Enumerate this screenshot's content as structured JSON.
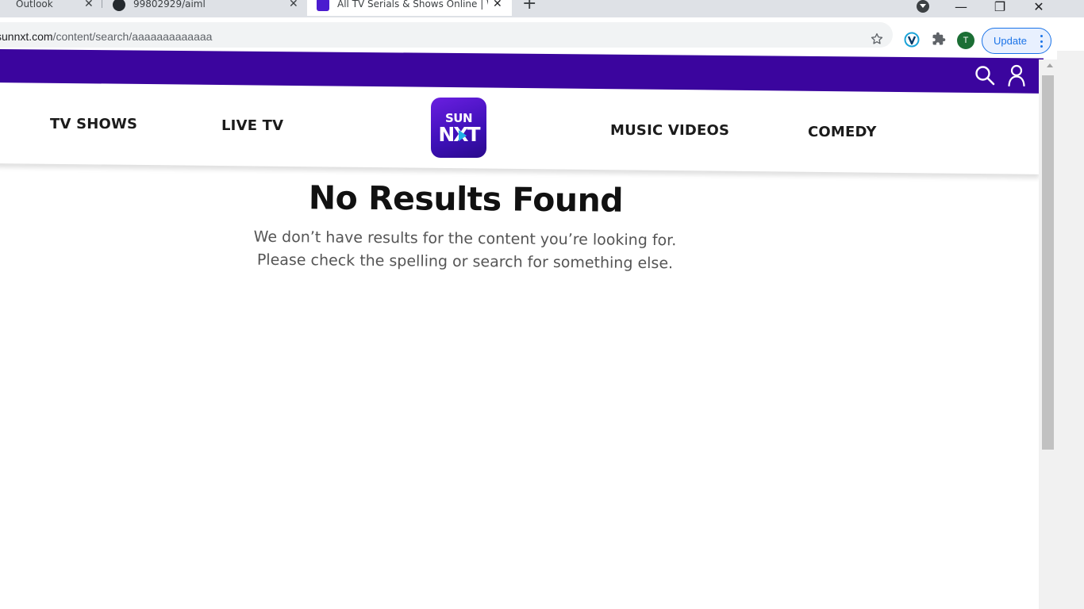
{
  "browser": {
    "tabs": [
      {
        "title": "Outlook",
        "active": false
      },
      {
        "title": "99802929/aiml",
        "active": false
      },
      {
        "title": "All TV Serials & Shows Online | W",
        "active": true
      }
    ],
    "new_tab_symbol": "+",
    "close_symbol": "✕",
    "url_host": "sunnxt.com",
    "url_path": "/content/search/aaaaaaaaaaaaa",
    "profile_initial": "T",
    "update_label": "Update",
    "window_controls": {
      "minimize": "—",
      "restore": "❐",
      "close": "✕"
    }
  },
  "header": {
    "icons": [
      "search-icon",
      "user-icon"
    ],
    "brand_color": "#3b059e"
  },
  "nav": {
    "items": [
      "TV SHOWS",
      "LIVE TV",
      "MUSIC VIDEOS",
      "COMEDY"
    ],
    "logo_top": "SUN",
    "logo_bottom": "NXT"
  },
  "search_result": {
    "heading": "No Results Found",
    "line1": "We don’t have results for the content you’re looking for.",
    "line2": "Please check the spelling or search for something else."
  }
}
